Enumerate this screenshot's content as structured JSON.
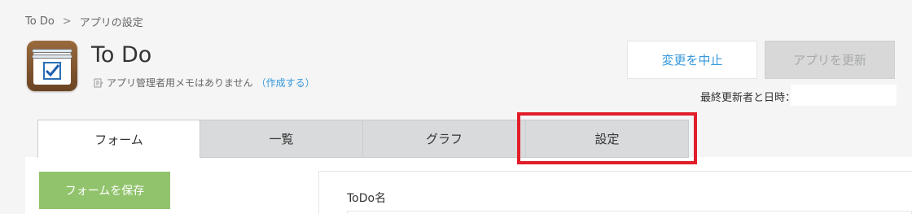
{
  "breadcrumb": {
    "items": [
      "To Do",
      "アプリの設定"
    ],
    "separator": ">"
  },
  "app": {
    "title": "To Do",
    "memo_text": "アプリ管理者用メモはありません",
    "memo_link": "（作成する）"
  },
  "actions": {
    "cancel_label": "変更を中止",
    "update_label": "アプリを更新"
  },
  "last_updated": {
    "label": "最終更新者と日時："
  },
  "tabs": [
    {
      "label": "フォーム",
      "active": true
    },
    {
      "label": "一覧",
      "active": false
    },
    {
      "label": "グラフ",
      "active": false
    },
    {
      "label": "設定",
      "active": false,
      "highlighted": true
    }
  ],
  "form": {
    "save_label": "フォームを保存",
    "field_label": "ToDo名"
  },
  "colors": {
    "accent": "#3498db",
    "save": "#91c36c",
    "highlight": "#e11d2a"
  }
}
